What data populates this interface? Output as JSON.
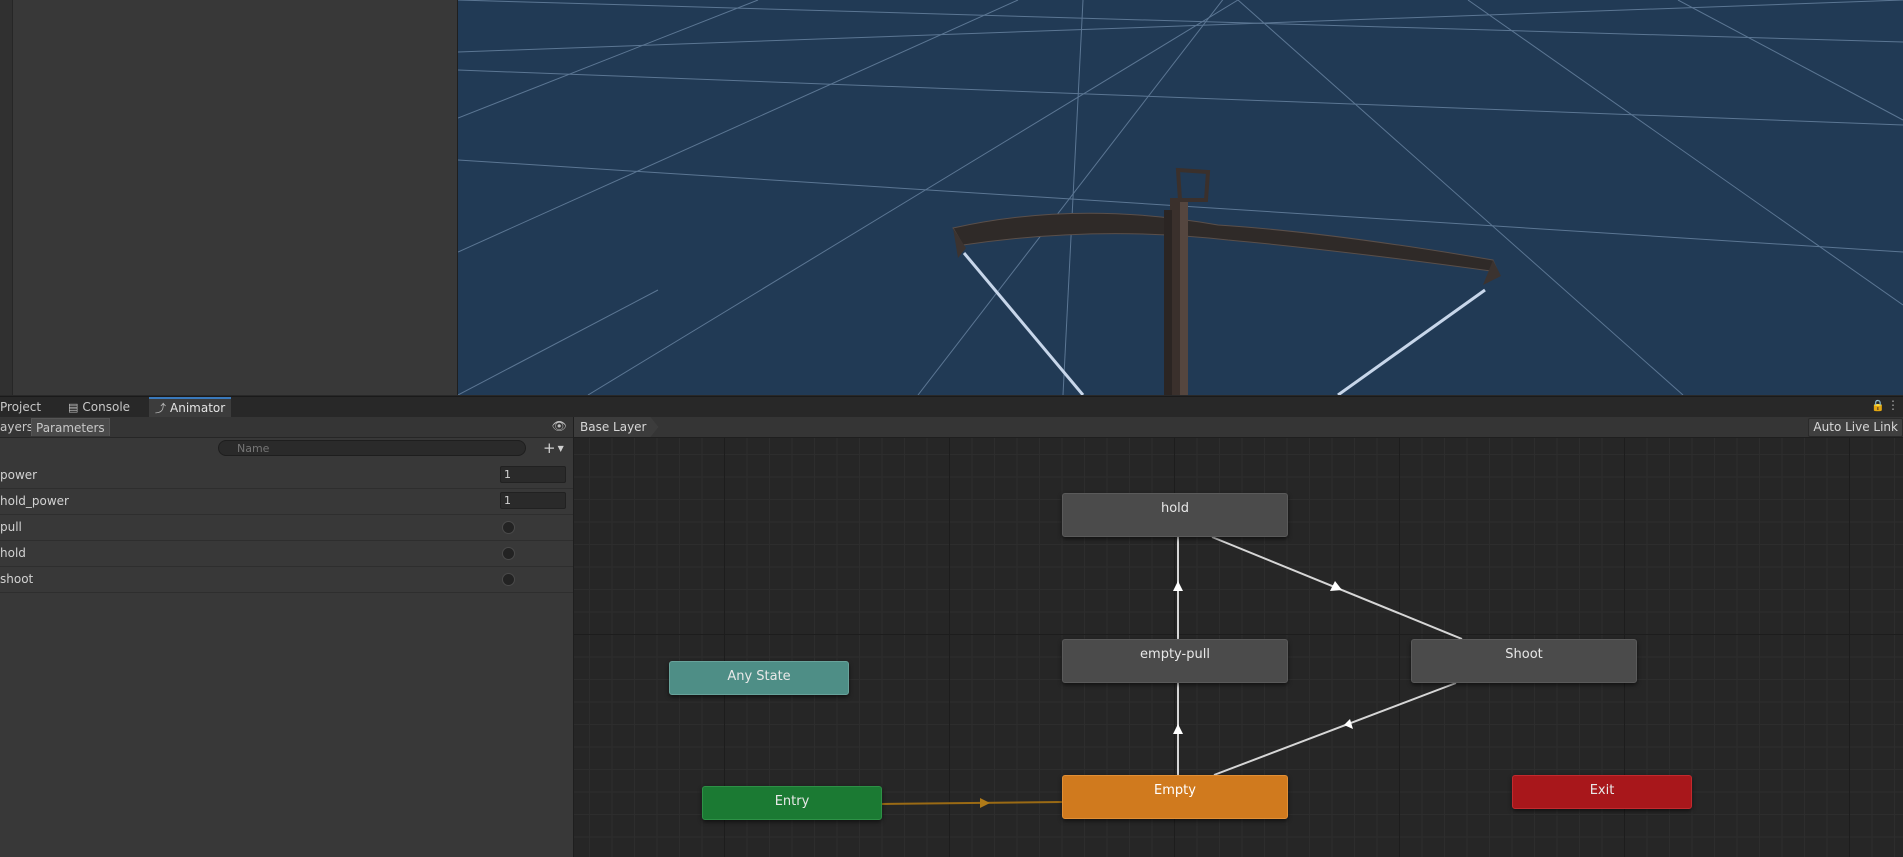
{
  "window": {
    "tabs": [
      {
        "label": "Project",
        "icon": "folder-icon",
        "active": false
      },
      {
        "label": "Console",
        "icon": "console-icon",
        "active": false
      },
      {
        "label": "Animator",
        "icon": "animator-icon",
        "active": true
      }
    ]
  },
  "parameters_panel": {
    "subtabs": [
      {
        "label": "Layers",
        "visible_text": "ayers",
        "active": false
      },
      {
        "label": "Parameters",
        "active": true
      }
    ],
    "search_placeholder": "Name",
    "add_label": "+",
    "params": [
      {
        "name": "power",
        "type": "float",
        "value": "1"
      },
      {
        "name": "hold_power",
        "type": "float",
        "value": "1"
      },
      {
        "name": "pull",
        "type": "bool",
        "value": false
      },
      {
        "name": "hold",
        "type": "bool",
        "value": false
      },
      {
        "name": "shoot",
        "type": "bool",
        "value": false
      }
    ]
  },
  "graph": {
    "breadcrumb": "Base Layer",
    "auto_live_link": "Auto Live Link",
    "states": {
      "hold": "hold",
      "empty_pull": "empty-pull",
      "shoot": "Shoot",
      "any_state": "Any State",
      "empty": "Empty",
      "entry": "Entry",
      "exit": "Exit"
    }
  },
  "colors": {
    "default_state": "#d07a1e",
    "entry": "#1b7a33",
    "exit": "#a8171b",
    "any_state": "#4e8e86",
    "state": "#4b4b4b",
    "transition": "#d6d6d6",
    "entry_transition": "#9a6a14",
    "accent_tab": "#3a79bb",
    "scene_background": "#213a55"
  }
}
